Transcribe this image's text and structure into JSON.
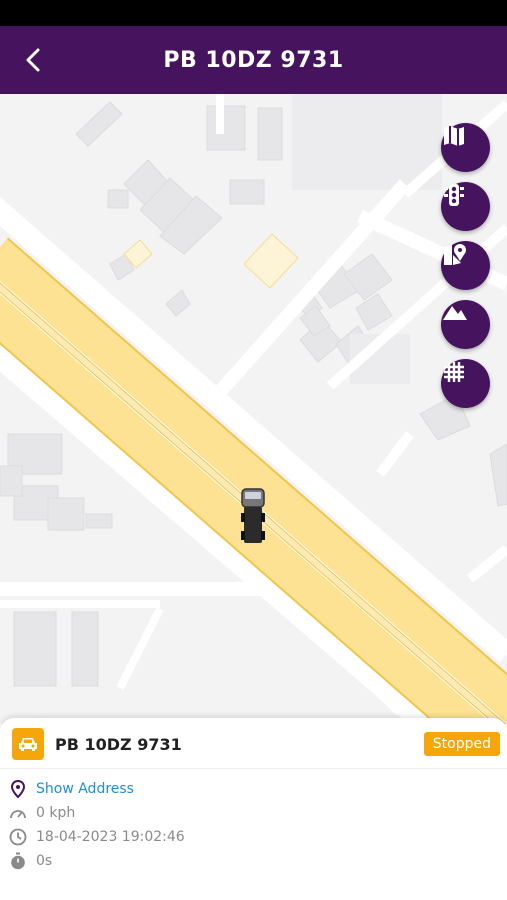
{
  "header": {
    "title": "PB 10DZ 9731",
    "back_icon": "chevron-left-icon"
  },
  "map_controls": [
    {
      "name": "map-type-button",
      "icon": "map-icon"
    },
    {
      "name": "traffic-button",
      "icon": "traffic-light-icon"
    },
    {
      "name": "geofence-button",
      "icon": "map-pin-icon"
    },
    {
      "name": "terrain-button",
      "icon": "mountain-icon"
    },
    {
      "name": "grid-button",
      "icon": "grid-icon"
    }
  ],
  "vehicle": {
    "name": "PB 10DZ 9731",
    "status": "Stopped",
    "status_color": "#f5a60b",
    "address_link": "Show Address",
    "speed": "0 kph",
    "timestamp": "18-04-2023 19:02:46",
    "duration": "0s"
  },
  "colors": {
    "header": "#46145e",
    "accent": "#f5a60b",
    "link": "#1e8fd6",
    "road": "#fde293"
  }
}
